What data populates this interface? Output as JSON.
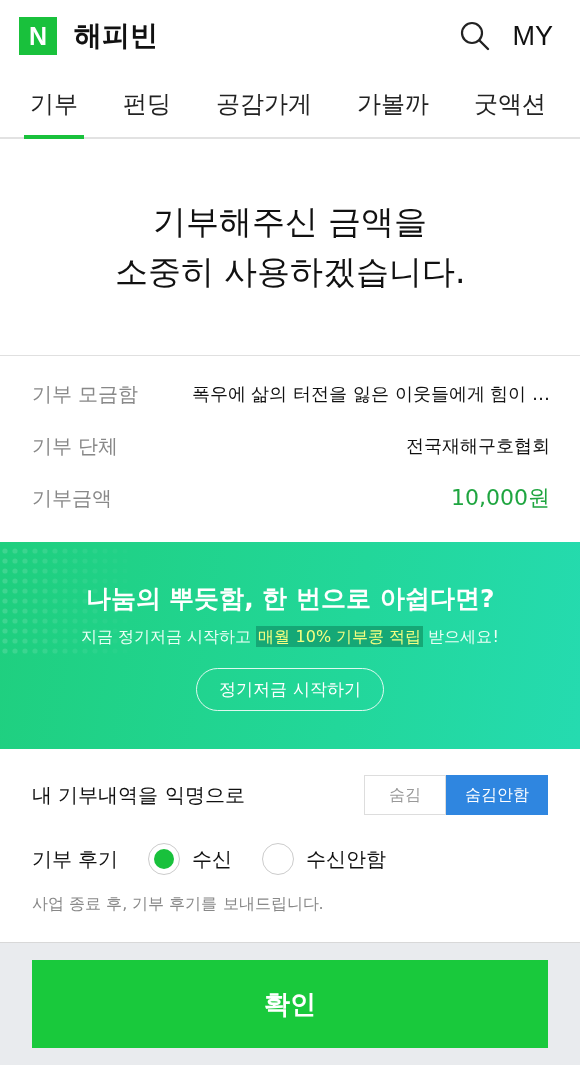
{
  "header": {
    "logo": "N",
    "title": "해피빈",
    "my": "MY"
  },
  "tabs": [
    {
      "label": "기부",
      "selected": true
    },
    {
      "label": "펀딩",
      "selected": false
    },
    {
      "label": "공감가게",
      "selected": false
    },
    {
      "label": "가볼까",
      "selected": false
    },
    {
      "label": "굿액션",
      "selected": false
    }
  ],
  "headline": [
    "기부해주신 금액을",
    "소중히 사용하겠습니다."
  ],
  "details": [
    {
      "label": "기부 모금함",
      "value": "폭우에 삶의 터전을 잃은 이웃들에게 힘이 …",
      "kind": "text"
    },
    {
      "label": "기부 단체",
      "value": "전국재해구호협회",
      "kind": "text"
    },
    {
      "label": "기부금액",
      "value": "10,000원",
      "kind": "amount"
    }
  ],
  "banner": {
    "title": "나눔의 뿌듯함, 한 번으로 아쉽다면?",
    "subtitle": [
      {
        "text": "지금 정기저금 시작하고 ",
        "highlight": false
      },
      {
        "text": "매월 10% 기부콩 적립",
        "highlight": true
      },
      {
        "text": " 받으세요!",
        "highlight": false
      }
    ],
    "button": "정기저금 시작하기"
  },
  "anonymous": {
    "label": "내 기부내역을 익명으로",
    "options": [
      {
        "label": "숨김",
        "selected": false
      },
      {
        "label": "숨김안함",
        "selected": true
      }
    ]
  },
  "review": {
    "label": "기부 후기",
    "options": [
      {
        "label": "수신",
        "selected": true
      },
      {
        "label": "수신안함",
        "selected": false
      }
    ],
    "note": "사업 종료 후, 기부 후기를 보내드립니다."
  },
  "confirm": "확인"
}
